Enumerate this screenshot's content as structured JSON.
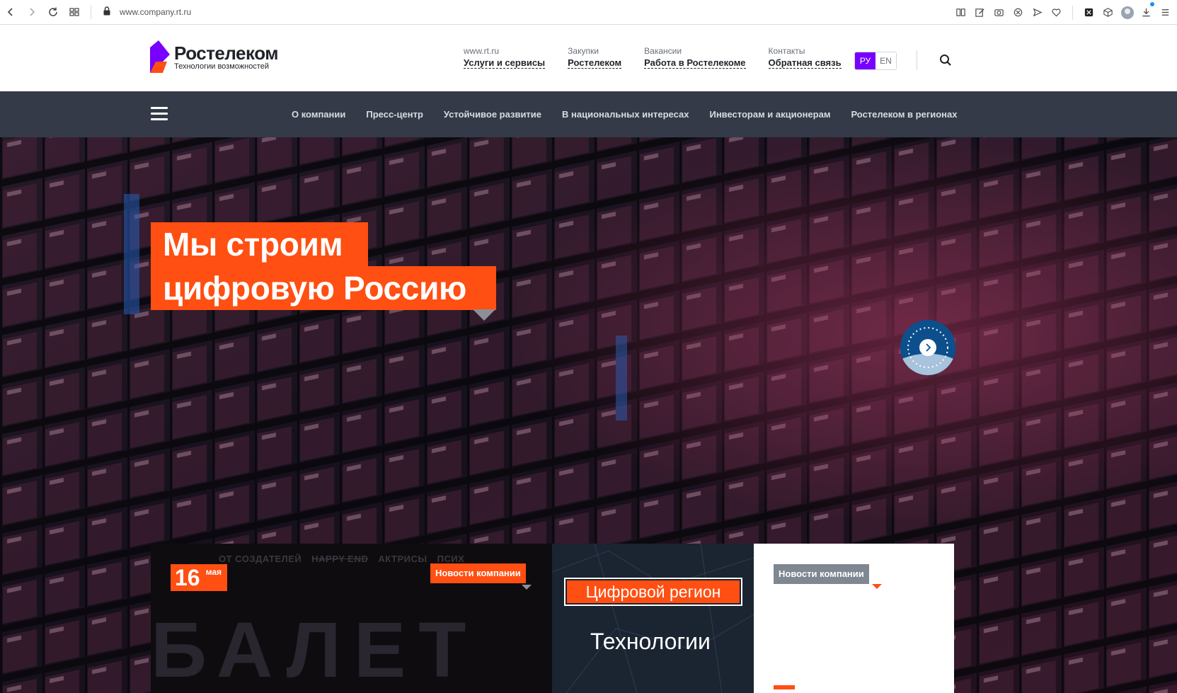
{
  "browser": {
    "url": "www.company.rt.ru"
  },
  "header": {
    "logo_name": "Ростелеком",
    "logo_slogan": "Технологии возможностей",
    "top_links": [
      {
        "small": "www.rt.ru",
        "main": "Услуги и сервисы"
      },
      {
        "small": "Закупки",
        "main": "Ростелеком"
      },
      {
        "small": "Вакансии",
        "main": "Работа в Ростелекоме"
      },
      {
        "small": "Контакты",
        "main": "Обратная связь"
      }
    ],
    "lang_ru": "РУ",
    "lang_en": "EN",
    "colors": {
      "brand_purple": "#7700ff",
      "brand_orange": "#ff4f12"
    }
  },
  "nav": {
    "items": [
      "О компании",
      "Пресс-центр",
      "Устойчивое развитие",
      "В национальных интересах",
      "Инвесторам и акционерам",
      "Ростелеком в регионах"
    ],
    "background": "#343a47"
  },
  "hero": {
    "title_line1": "Мы строим",
    "title_line2": "цифровую Россию"
  },
  "cards": {
    "card1": {
      "date_day": "16",
      "date_month": "мая",
      "tag": "Новости компании",
      "credits": [
        "ОТ СОЗДАТЕЛЕЙ",
        "HAPPY END",
        "АКТРИСЫ",
        "ПСИХ"
      ],
      "big_text": "БАЛЕТ"
    },
    "card2": {
      "label": "Цифровой регион",
      "headline": "Технологии"
    },
    "card3": {
      "tag": "Новости компании"
    }
  }
}
